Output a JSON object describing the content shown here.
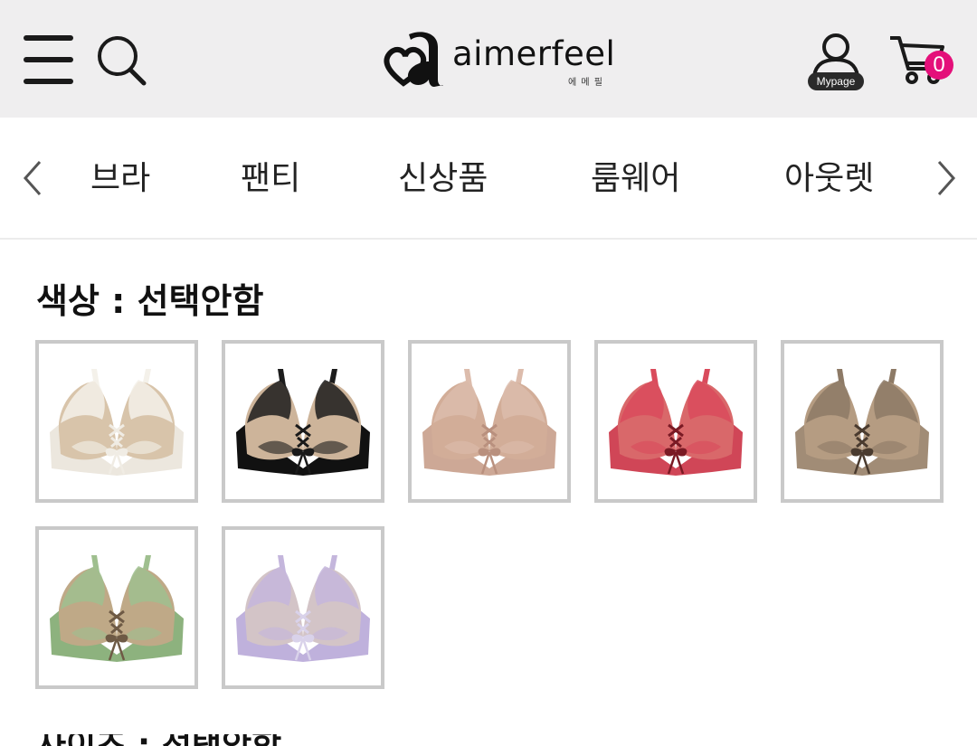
{
  "header": {
    "brand_name": "aimerfeel",
    "brand_subtitle": "에 메 필",
    "mypage_label": "Mypage",
    "cart_count": "0",
    "colors": {
      "bar_bg": "#efeeef",
      "cart_badge": "#e4107a"
    },
    "icons": [
      "menu-icon",
      "search-icon",
      "user-icon",
      "cart-icon"
    ]
  },
  "category_nav": {
    "items": [
      "브라",
      "팬티",
      "신상품",
      "룸웨어",
      "아웃렛"
    ]
  },
  "color_section": {
    "title": "색상 : 선택안함",
    "swatches": [
      {
        "name": "ivory",
        "cup": "#d8c4aa",
        "lace": "#f4f1ea",
        "band": "#ece7de",
        "ribbon": "#f0ece4"
      },
      {
        "name": "black",
        "cup": "#cdb49a",
        "lace": "#1c1c1c",
        "band": "#111111",
        "ribbon": "#1a1a1a"
      },
      {
        "name": "beige",
        "cup": "#d2ad98",
        "lace": "#dcbcac",
        "band": "#cda896",
        "ribbon": "#b9907e"
      },
      {
        "name": "red",
        "cup": "#d9686a",
        "lace": "#d94b5c",
        "band": "#d04657",
        "ribbon": "#7a1a24"
      },
      {
        "name": "mocha",
        "cup": "#b59c82",
        "lace": "#8d7a66",
        "band": "#a18c76",
        "ribbon": "#4a3b2f"
      },
      {
        "name": "green",
        "cup": "#bfa987",
        "lace": "#9fbf8f",
        "band": "#8db27e",
        "ribbon": "#6e5a45"
      },
      {
        "name": "lavender",
        "cup": "#d3c4c7",
        "lace": "#c4b6dc",
        "band": "#bfb1dc",
        "ribbon": "#d9d2ea"
      }
    ]
  }
}
